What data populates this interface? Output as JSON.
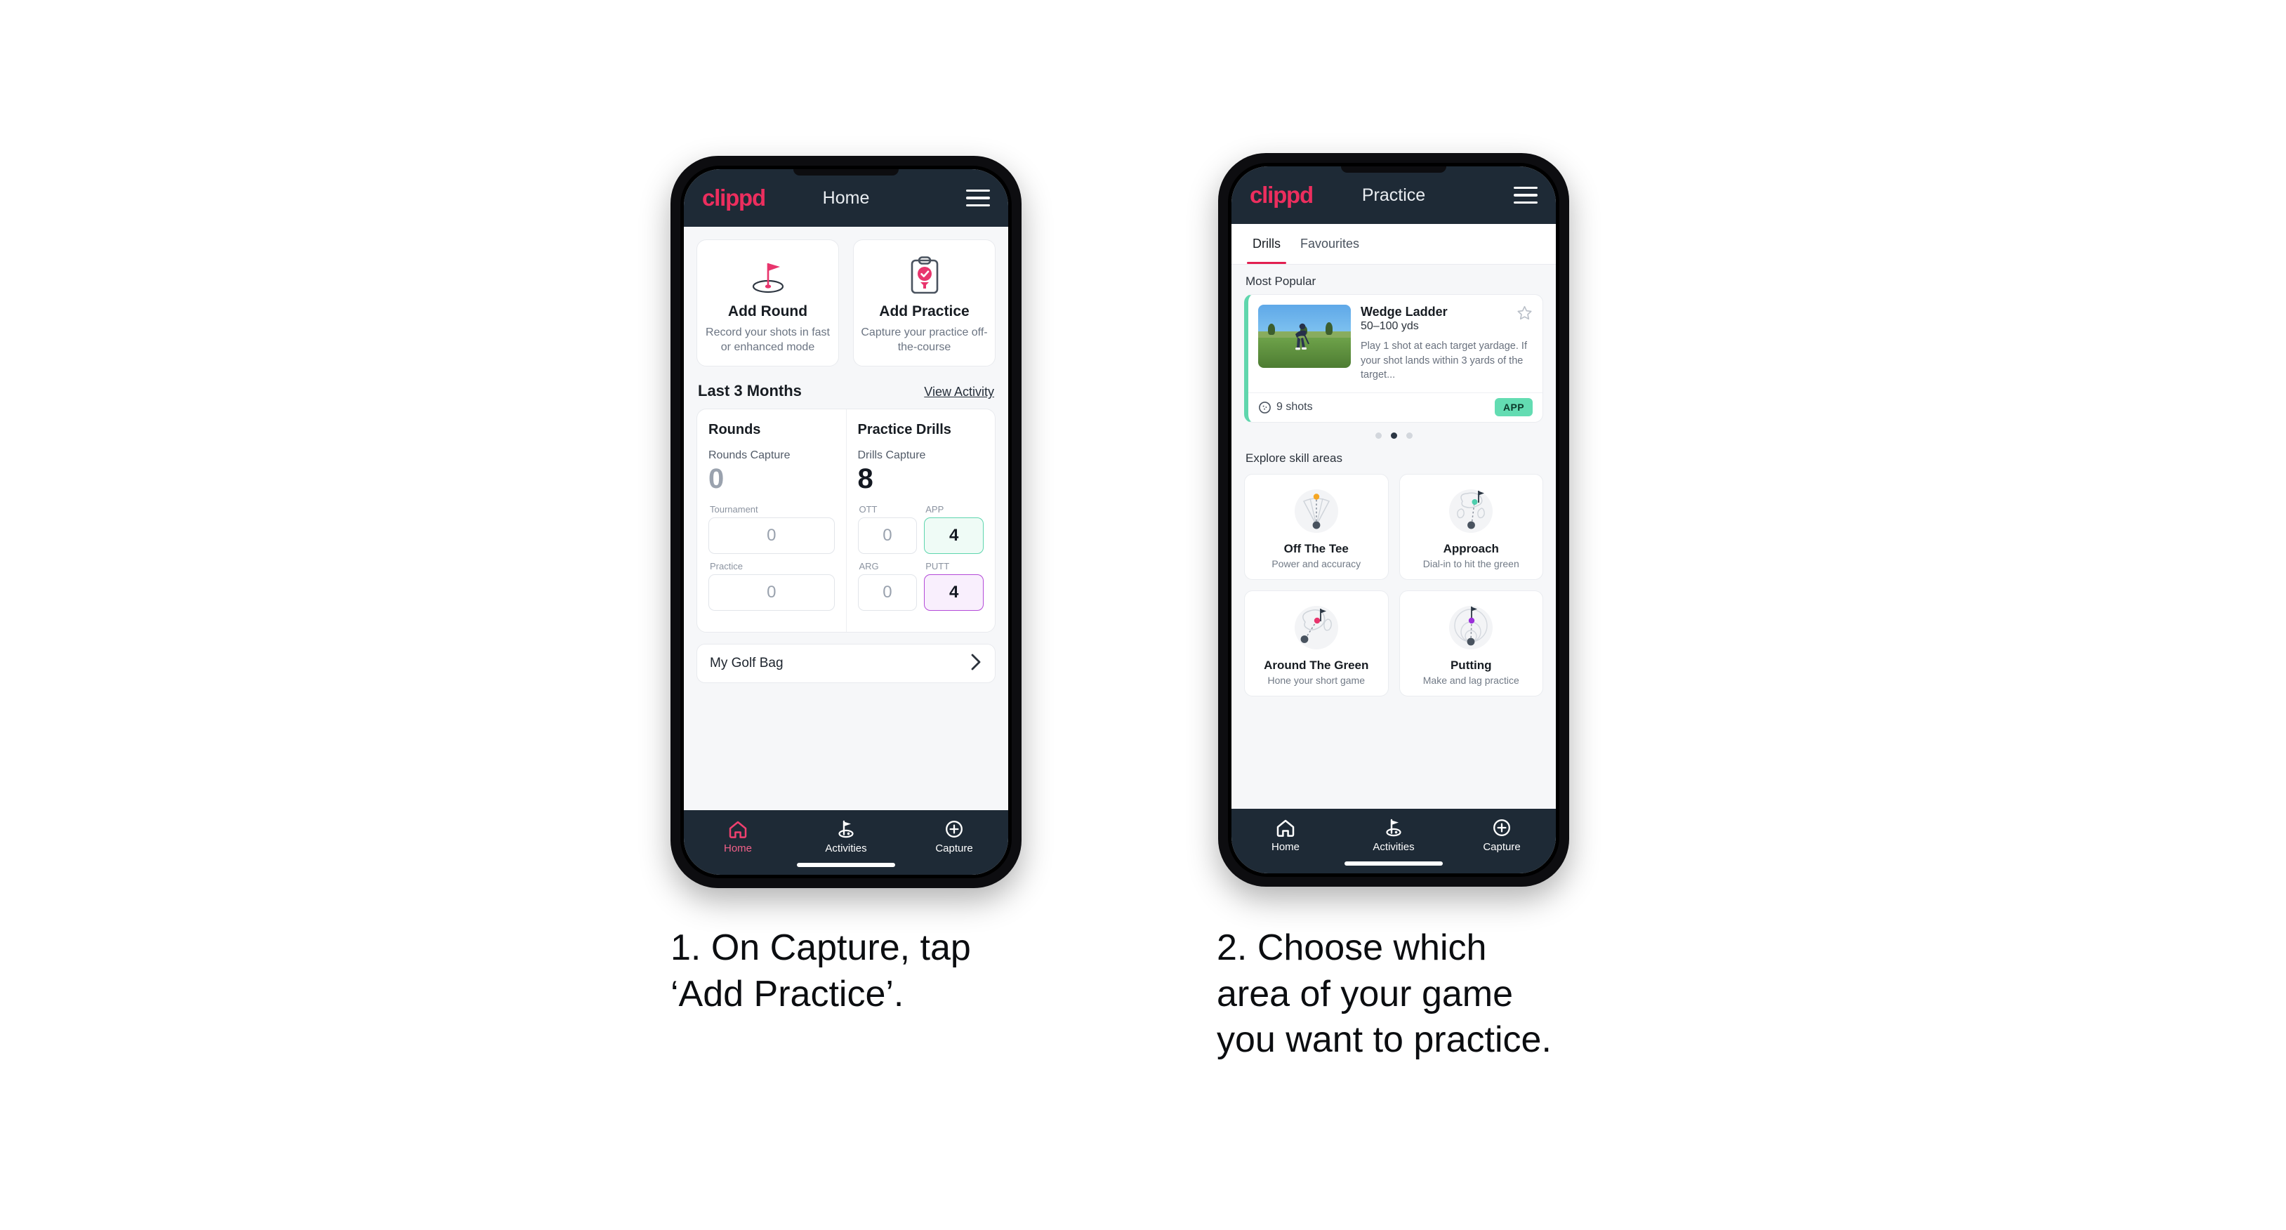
{
  "phones": [
    {
      "id": "home",
      "brand": "clippd",
      "title": "Home",
      "quick_actions": [
        {
          "icon": "golf-flag-hole-icon",
          "title": "Add Round",
          "subtitle": "Record your shots in fast or enhanced mode"
        },
        {
          "icon": "clipboard-check-tee-icon",
          "title": "Add Practice",
          "subtitle": "Capture your practice off-the-course"
        }
      ],
      "section": {
        "title": "Last 3 Months",
        "link": "View Activity"
      },
      "stats": [
        {
          "heading": "Rounds",
          "capture_label": "Rounds Capture",
          "capture_value": "0",
          "capture_is_zero": true,
          "fields": [
            {
              "label": "Tournament",
              "value": "0",
              "accent": "none",
              "zero": true
            },
            {
              "label": "Practice",
              "value": "0",
              "accent": "none",
              "zero": true
            }
          ]
        },
        {
          "heading": "Practice Drills",
          "capture_label": "Drills Capture",
          "capture_value": "8",
          "capture_is_zero": false,
          "fields": [
            {
              "label": "OTT",
              "value": "0",
              "accent": "none",
              "zero": true
            },
            {
              "label": "APP",
              "value": "4",
              "accent": "green",
              "zero": false
            },
            {
              "label": "ARG",
              "value": "0",
              "accent": "none",
              "zero": true
            },
            {
              "label": "PUTT",
              "value": "4",
              "accent": "purple",
              "zero": false
            }
          ]
        }
      ],
      "golf_bag": {
        "label": "My Golf Bag",
        "chevron": "chevron-right-icon"
      },
      "nav": [
        {
          "label": "Home",
          "icon": "home-icon",
          "active": true
        },
        {
          "label": "Activities",
          "icon": "golf-flag-icon",
          "active": false
        },
        {
          "label": "Capture",
          "icon": "plus-circle-icon",
          "active": false
        }
      ]
    },
    {
      "id": "practice",
      "brand": "clippd",
      "title": "Practice",
      "tabs": [
        {
          "label": "Drills",
          "active": true
        },
        {
          "label": "Favourites",
          "active": false
        }
      ],
      "most_popular_label": "Most Popular",
      "drill": {
        "name": "Wedge Ladder",
        "yardage": "50–100 yds",
        "description": "Play 1 shot at each target yardage. If your shot lands within 3 yards of the target...",
        "shots": "9 shots",
        "badge": "APP",
        "star": "star-outline-icon",
        "accent_color": "#5fd6ad",
        "badge_color": "#63dcb2",
        "next_card_color": "#a93ad6"
      },
      "carousel_dots": {
        "count": 3,
        "active_index": 1
      },
      "skill_section_label": "Explore skill areas",
      "skills": [
        {
          "title": "Off The Tee",
          "subtitle": "Power and accuracy",
          "icon": "tee-dispersion-icon",
          "dot_color": "#f5a623"
        },
        {
          "title": "Approach",
          "subtitle": "Dial-in to hit the green",
          "icon": "approach-green-icon",
          "dot_color": "#4ecfae"
        },
        {
          "title": "Around The Green",
          "subtitle": "Hone your short game",
          "icon": "chip-green-icon",
          "dot_color": "#e8356d"
        },
        {
          "title": "Putting",
          "subtitle": "Make and lag practice",
          "icon": "putting-rings-icon",
          "dot_color": "#9b30d9"
        }
      ],
      "nav": [
        {
          "label": "Home",
          "icon": "home-icon",
          "active": false
        },
        {
          "label": "Activities",
          "icon": "golf-flag-icon",
          "active": false
        },
        {
          "label": "Capture",
          "icon": "plus-circle-icon",
          "active": false
        }
      ]
    }
  ],
  "captions": [
    {
      "text": "1. On Capture, tap\n‘Add Practice’."
    },
    {
      "text": "2. Choose which\narea of your game\nyou want to practice."
    }
  ],
  "colors": {
    "brand_pink": "#ec2e5e",
    "header_dark": "#1e2a36",
    "accent_green": "#5fd6ad",
    "accent_purple": "#a93ad6",
    "page_bg": "#ffffff"
  }
}
